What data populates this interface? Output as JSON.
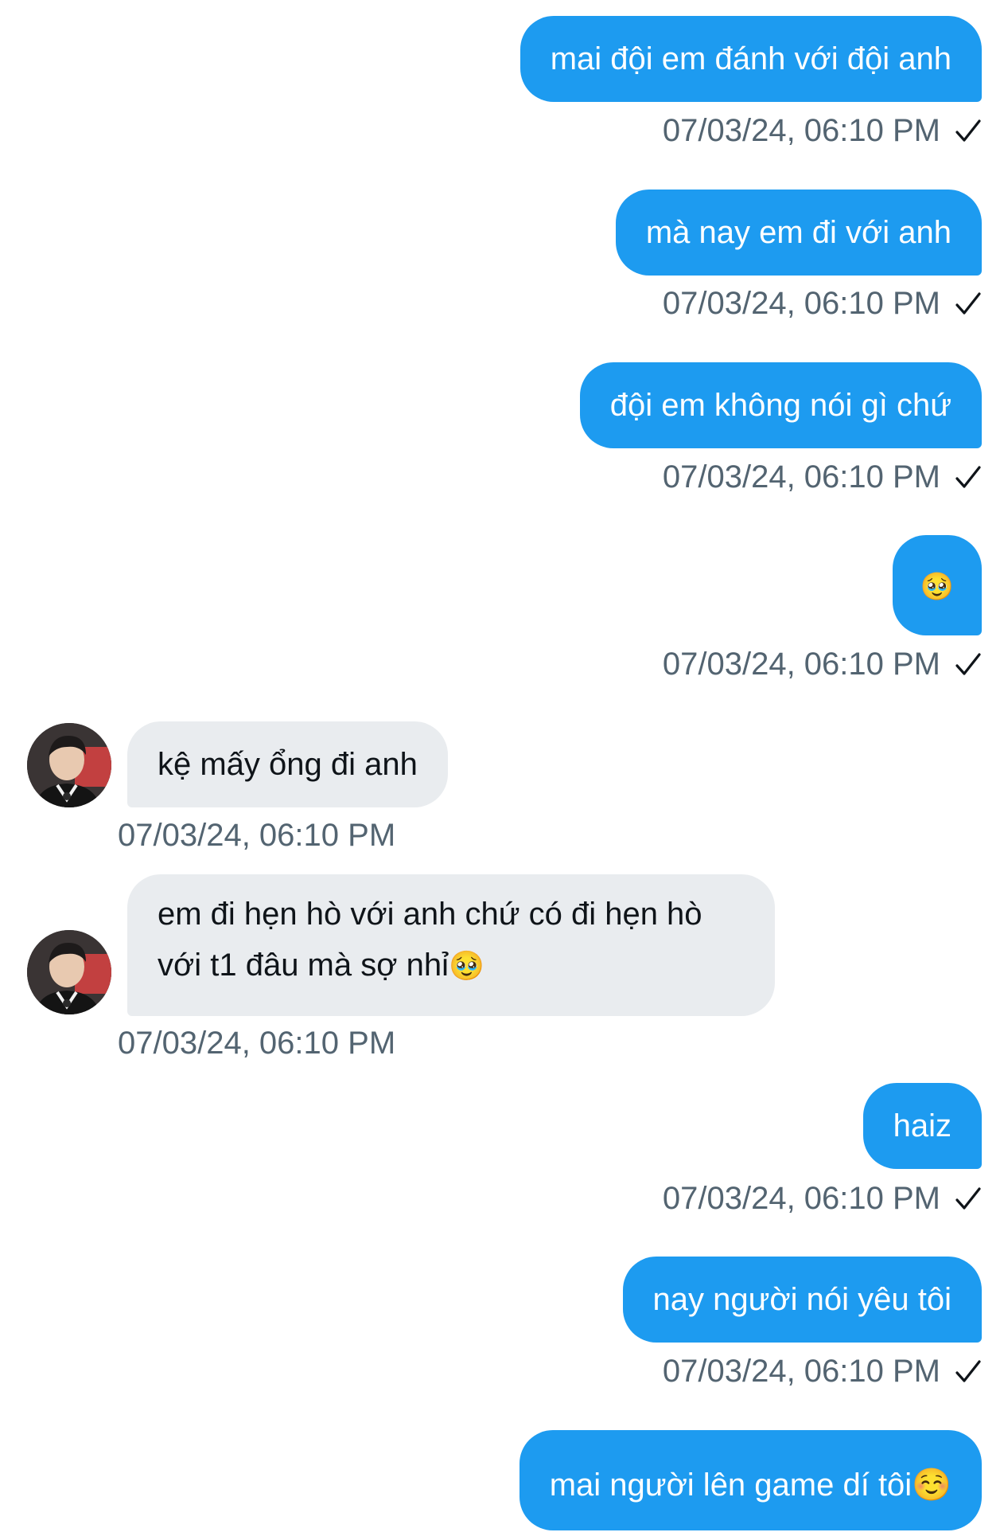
{
  "messages": [
    {
      "text": "mai đội em đánh với đội anh",
      "time": "07/03/24, 06:10 PM"
    },
    {
      "text": "mà nay em đi với anh",
      "time": "07/03/24, 06:10 PM"
    },
    {
      "text": "đội em không nói gì chứ",
      "time": "07/03/24, 06:10 PM"
    },
    {
      "text": "🥹",
      "time": "07/03/24, 06:10 PM"
    },
    {
      "text": "kệ mấy ổng đi anh",
      "time": "07/03/24, 06:10 PM"
    },
    {
      "text_part1": "em đi hẹn hò với anh chứ có đi hẹn hò",
      "text_part2": "với t1 đâu mà sợ nhỉ",
      "emoji": "🥹",
      "time": "07/03/24, 06:10 PM"
    },
    {
      "text": "haiz",
      "time": "07/03/24, 06:10 PM"
    },
    {
      "text": "nay người nói yêu tôi",
      "time": "07/03/24, 06:10 PM"
    },
    {
      "text": "mai người lên game dí tôi☺️"
    }
  ],
  "colors": {
    "sent_bubble": "#1d9bf0",
    "received_bubble": "#e9ecef",
    "timestamp": "#536471"
  }
}
